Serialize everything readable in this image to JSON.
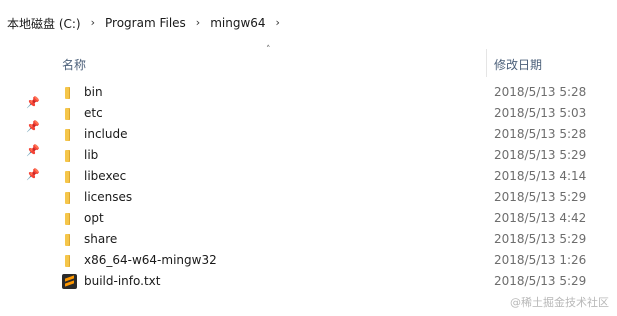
{
  "breadcrumb": {
    "items": [
      "本地磁盘 (C:)",
      "Program Files",
      "mingw64"
    ],
    "separator": "›"
  },
  "columns": {
    "name": "名称",
    "date_modified": "修改日期",
    "sort_indicator": "˄"
  },
  "files": [
    {
      "name": "bin",
      "date": "2018/5/13 5:28",
      "type": "folder"
    },
    {
      "name": "etc",
      "date": "2018/5/13 5:03",
      "type": "folder"
    },
    {
      "name": "include",
      "date": "2018/5/13 5:28",
      "type": "folder"
    },
    {
      "name": "lib",
      "date": "2018/5/13 5:29",
      "type": "folder"
    },
    {
      "name": "libexec",
      "date": "2018/5/13 4:14",
      "type": "folder"
    },
    {
      "name": "licenses",
      "date": "2018/5/13 5:29",
      "type": "folder"
    },
    {
      "name": "opt",
      "date": "2018/5/13 4:42",
      "type": "folder"
    },
    {
      "name": "share",
      "date": "2018/5/13 5:29",
      "type": "folder"
    },
    {
      "name": "x86_64-w64-mingw32",
      "date": "2018/5/13 1:26",
      "type": "folder"
    },
    {
      "name": "build-info.txt",
      "date": "2018/5/13 5:29",
      "type": "text-file"
    }
  ],
  "pins": [
    "pin-icon",
    "pin-icon",
    "pin-icon",
    "pin-icon"
  ],
  "watermark": "@稀土掘金技术社区",
  "colors": {
    "folder": "#f5c64a",
    "header_text": "#4c607a",
    "date_text": "#6d6d6d"
  }
}
